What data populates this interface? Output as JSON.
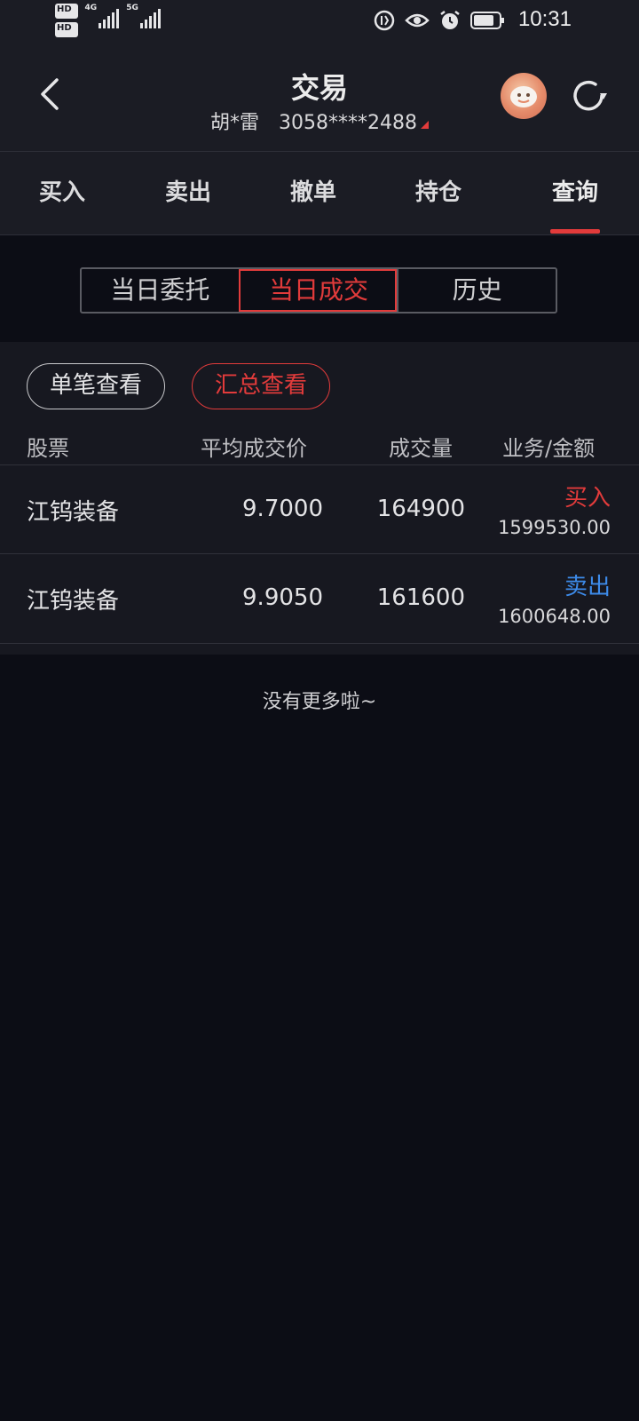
{
  "status_bar": {
    "sim1": "HD",
    "sim1_index": "1",
    "sim2": "HD",
    "sim2_index": "2",
    "net1": "4G",
    "net2": "5G",
    "time": "10:31",
    "icons": [
      "data-saver-icon",
      "eye-icon",
      "alarm-icon",
      "battery-icon"
    ]
  },
  "header": {
    "title": "交易",
    "account_name": "胡*雷",
    "account_number": "3058****2488"
  },
  "tabs": [
    {
      "label": "买入"
    },
    {
      "label": "卖出"
    },
    {
      "label": "撤单"
    },
    {
      "label": "持仓"
    },
    {
      "label": "查询",
      "active": true
    }
  ],
  "segments": [
    {
      "label": "当日委托"
    },
    {
      "label": "当日成交",
      "active": true
    },
    {
      "label": "历史"
    }
  ],
  "view_toggle": {
    "single": "单笔查看",
    "summary": "汇总查看",
    "active": "summary"
  },
  "table": {
    "columns": [
      "股票",
      "平均成交价",
      "成交量",
      "业务/金额"
    ],
    "rows": [
      {
        "name": "江钨装备",
        "avg_price": "9.7000",
        "volume": "164900",
        "business": "买入",
        "amount": "1599530.00"
      },
      {
        "name": "江钨装备",
        "avg_price": "9.9050",
        "volume": "161600",
        "business": "卖出",
        "amount": "1600648.00"
      }
    ]
  },
  "footer_text": "没有更多啦~",
  "colors": {
    "accent_red": "#e23b3b",
    "sell_blue": "#3d8bea",
    "background": "#0c0d15"
  }
}
